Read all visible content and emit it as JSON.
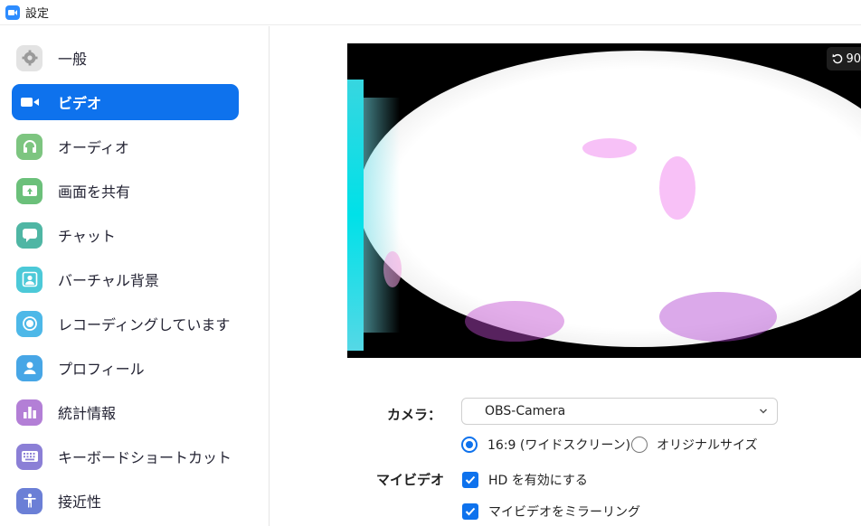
{
  "window": {
    "title": "設定",
    "app_icon": "zoom-video-icon"
  },
  "sidebar": {
    "items": [
      {
        "label": "一般",
        "icon": "gear-icon",
        "color": "#e3e3e3",
        "active": false
      },
      {
        "label": "ビデオ",
        "icon": "video-camera-icon",
        "color": "#0e72ed",
        "active": true
      },
      {
        "label": "オーディオ",
        "icon": "headphones-icon",
        "color": "#7dc580",
        "active": false
      },
      {
        "label": "画面を共有",
        "icon": "share-screen-icon",
        "color": "#6bc07a",
        "active": false
      },
      {
        "label": "チャット",
        "icon": "chat-bubble-icon",
        "color": "#4fb6a4",
        "active": false
      },
      {
        "label": "バーチャル背景",
        "icon": "person-portrait-icon",
        "color": "#4cc9d8",
        "active": false
      },
      {
        "label": "レコーディングしています",
        "icon": "record-icon",
        "color": "#4db8e8",
        "active": false
      },
      {
        "label": "プロフィール",
        "icon": "profile-icon",
        "color": "#47a6e6",
        "active": false
      },
      {
        "label": "統計情報",
        "icon": "bar-chart-icon",
        "color": "#b37fd6",
        "active": false
      },
      {
        "label": "キーボードショートカット",
        "icon": "keyboard-icon",
        "color": "#8b7fd6",
        "active": false
      },
      {
        "label": "接近性",
        "icon": "accessibility-icon",
        "color": "#6b7fd6",
        "active": false
      }
    ]
  },
  "preview": {
    "rotate_label": "90"
  },
  "camera": {
    "label": "カメラ：",
    "selected": "OBS-Camera"
  },
  "aspect": {
    "options": [
      {
        "label": "16:9 (ワイドスクリーン)",
        "selected": true
      },
      {
        "label": "オリジナルサイズ",
        "selected": false
      }
    ]
  },
  "my_video": {
    "label": "マイビデオ",
    "options": [
      {
        "label": "HD を有効にする",
        "checked": true
      },
      {
        "label": "マイビデオをミラーリング",
        "checked": true
      }
    ]
  }
}
